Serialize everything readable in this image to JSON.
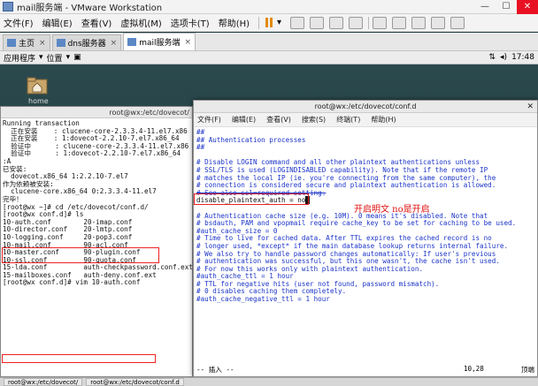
{
  "vm": {
    "title": "mail服务端 - VMware Workstation",
    "menu": [
      "文件(F)",
      "编辑(E)",
      "查看(V)",
      "虚拟机(M)",
      "选项卡(T)",
      "帮助(H)"
    ],
    "tabs": [
      {
        "label": "主页"
      },
      {
        "label": "dns服务器"
      },
      {
        "label": "mail服务端"
      }
    ]
  },
  "panel": {
    "apps": "应用程序",
    "places": "位置",
    "time": "17:48"
  },
  "desktop": {
    "home_label": "home"
  },
  "terminal1": {
    "title": "root@wx:/etc/dovecot/",
    "lines": [
      "Running transaction",
      "  正在安装    : clucene-core-2.3.3.4-11.el7.x86",
      "  正在安装    : 1:dovecot-2.2.10-7.el7.x86_64",
      "  验证中      : clucene-core-2.3.3.4-11.el7.x86",
      "  验证中      : 1:dovecot-2.2.10-7.el7.x86_64",
      ":A",
      "已安装:",
      "  dovecot.x86_64 1:2.2.10-7.el7",
      "",
      "作为依赖被安装:",
      "  clucene-core.x86_64 0:2.3.3.4-11.el7",
      "",
      "完毕！",
      "[root@wx ~]# cd /etc/dovecot/conf.d/",
      "[root@wx conf.d]# ls",
      "10-auth.conf        20-imap.conf",
      "10-director.conf    20-lmtp.conf",
      "10-logging.conf     20-pop3.conf",
      "10-mail.conf        90-acl.conf",
      "10-master.conf      90-plugin.conf",
      "10-ssl.conf         90-quota.conf",
      "15-lda.conf         auth-checkpassword.conf.ext",
      "15-mailboxes.conf   auth-deny.conf.ext",
      "[root@wx conf.d]# vim 10-auth.conf"
    ]
  },
  "terminal2": {
    "title": "root@wx:/etc/dovecot/conf.d",
    "menu": [
      "文件(F)",
      "编辑(E)",
      "查看(V)",
      "搜索(S)",
      "终端(T)",
      "帮助(H)"
    ],
    "lines": [
      "##",
      "## Authentication processes",
      "##",
      "",
      "# Disable LOGIN command and all other plaintext authentications unless",
      "# SSL/TLS is used (LOGINDISABLED capability). Note that if the remote IP",
      "# matches the local IP (ie. you're connecting from the same computer), the",
      "# connection is considered secure and plaintext authentication is allowed.",
      "# See also ssl=required setting.",
      "disable_plaintext_auth = no",
      "",
      "# Authentication cache size (e.g. 10M). 0 means it's disabled. Note that",
      "# bsdauth, PAM and vpopmail require cache_key to be set for caching to be used.",
      "#auth_cache_size = 0",
      "# Time to live for cached data. After TTL expires the cached record is no",
      "# longer used, *except* if the main database lookup returns internal failure.",
      "# We also try to handle password changes automatically: If user's previous",
      "# authentication was successful, but this one wasn't, the cache isn't used.",
      "# For now this works only with plaintext authentication.",
      "#auth_cache_ttl = 1 hour",
      "# TTL for negative hits (user not found, password mismatch).",
      "# 0 disables caching them completely.",
      "#auth_cache_negative_ttl = 1 hour"
    ],
    "status_mode": "-- 插入 --",
    "status_pos": "10,28",
    "status_scroll": "顶端"
  },
  "annotation": "开启明文  no是开启",
  "taskbar": [
    "root@wx:/etc/dovecot/",
    "root@wx:/etc/dovecot/conf.d"
  ]
}
